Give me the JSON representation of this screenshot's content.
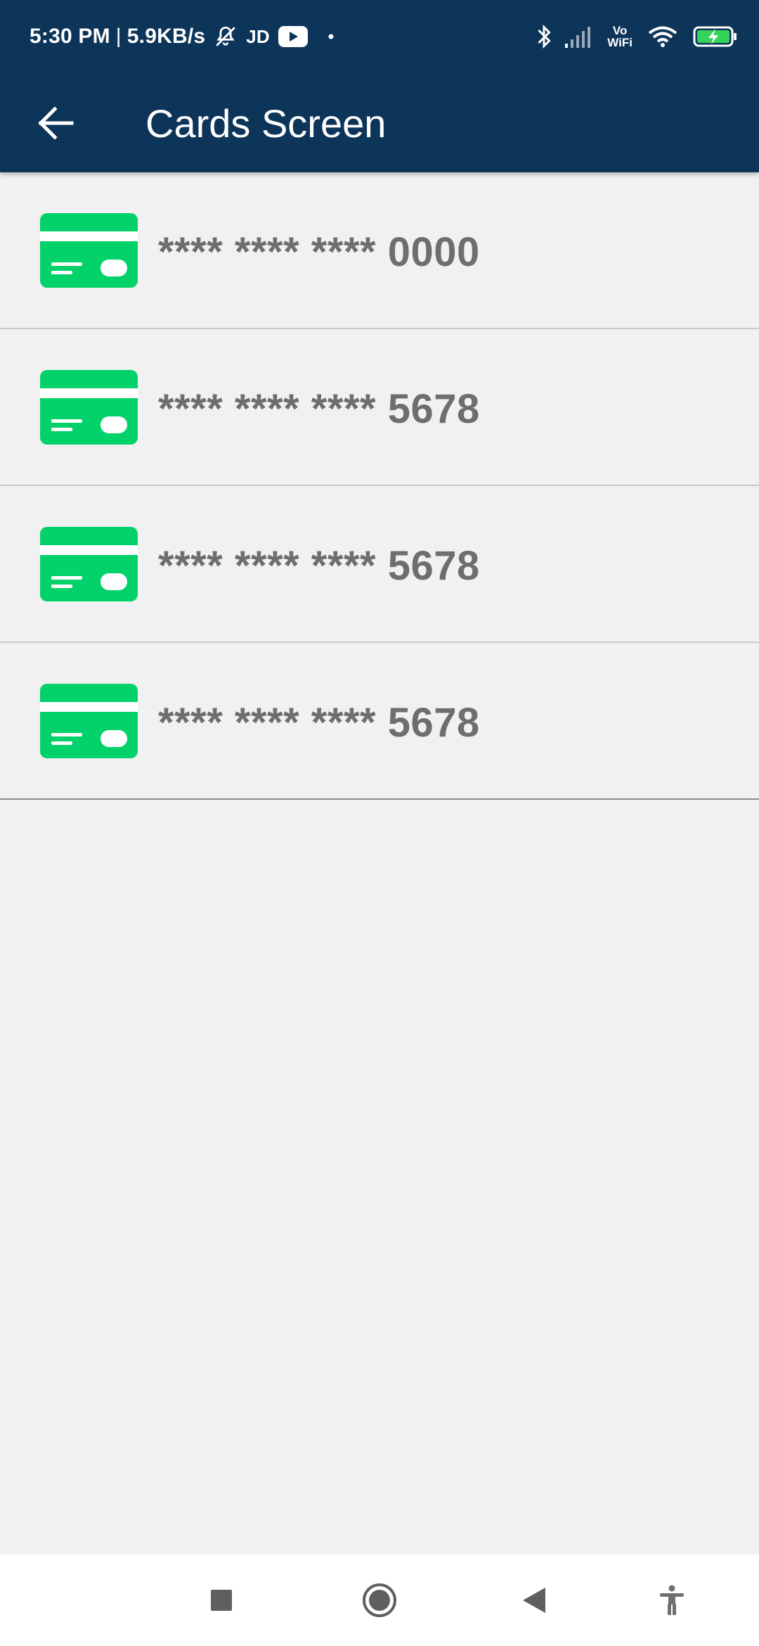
{
  "status_bar": {
    "time": "5:30 PM",
    "network_speed": "5.9KB/s",
    "carrier_tag": "JD",
    "vowifi_top": "Vo",
    "vowifi_bottom": "WiFi",
    "icons": [
      "mute-bell-icon",
      "youtube-icon",
      "dot-icon",
      "bluetooth-icon",
      "signal-icon",
      "vowifi-icon",
      "wifi-icon",
      "battery-charging-icon"
    ]
  },
  "app_bar": {
    "title": "Cards Screen",
    "back_icon": "arrow-left-icon"
  },
  "cards": [
    {
      "number": "**** **** **** 0000",
      "icon": "credit-card-icon"
    },
    {
      "number": "**** **** **** 5678",
      "icon": "credit-card-icon"
    },
    {
      "number": "**** **** **** 5678",
      "icon": "credit-card-icon"
    },
    {
      "number": "**** **** **** 5678",
      "icon": "credit-card-icon"
    }
  ],
  "nav_bar": {
    "buttons": [
      "recents-square-icon",
      "home-circle-icon",
      "back-triangle-icon",
      "accessibility-icon"
    ]
  },
  "colors": {
    "primary": "#0d3459",
    "card_green": "#03d16a",
    "background": "#f1f1f1",
    "card_text": "#6e6e6e"
  }
}
